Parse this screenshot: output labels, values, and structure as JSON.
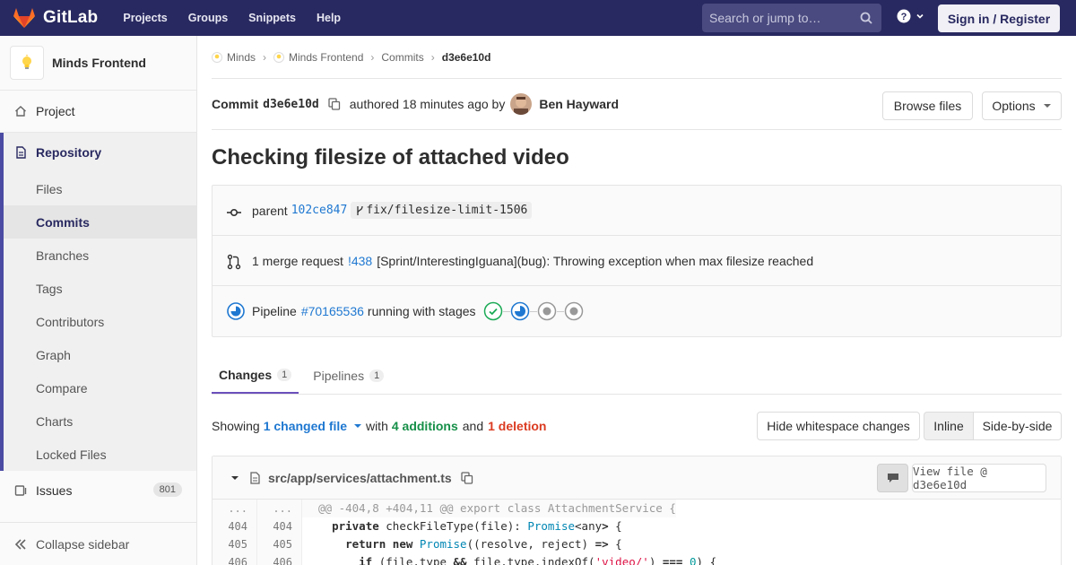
{
  "navbar": {
    "brand": "GitLab",
    "links": [
      "Projects",
      "Groups",
      "Snippets",
      "Help"
    ],
    "search_placeholder": "Search or jump to…",
    "signin_label": "Sign in / Register",
    "brand_color": "#292961"
  },
  "sidebar": {
    "project_name": "Minds Frontend",
    "project_item": "Project",
    "repository_label": "Repository",
    "repo_items": [
      "Files",
      "Commits",
      "Branches",
      "Tags",
      "Contributors",
      "Graph",
      "Compare",
      "Charts",
      "Locked Files"
    ],
    "active_item": "Commits",
    "issues_label": "Issues",
    "issues_count": "801",
    "collapse_label": "Collapse sidebar"
  },
  "breadcrumbs": [
    "Minds",
    "Minds Frontend",
    "Commits",
    "d3e6e10d"
  ],
  "commit": {
    "label": "Commit",
    "sha": "d3e6e10d",
    "authored": "authored 18 minutes ago by",
    "author": "Ben Hayward",
    "browse_files": "Browse files",
    "options": "Options",
    "title": "Checking filesize of attached video"
  },
  "info": {
    "parent_label": "parent",
    "parent_sha": "102ce847",
    "branch": "fix/filesize-limit-1506",
    "mr_count_text": "1 merge request",
    "mr_id": "!438",
    "mr_title": "[Sprint/InterestingIguana](bug): Throwing exception when max filesize reached",
    "pipeline_label": "Pipeline",
    "pipeline_id": "#70165536",
    "pipeline_status": "running with stages",
    "stages": [
      "success",
      "running",
      "created",
      "created"
    ]
  },
  "tabs": [
    {
      "label": "Changes",
      "count": "1"
    },
    {
      "label": "Pipelines",
      "count": "1"
    }
  ],
  "showing": {
    "prefix": "Showing",
    "files": "1 changed file",
    "with": "with",
    "additions": "4 additions",
    "and": "and",
    "deletions": "1 deletion",
    "hide_whitespace": "Hide whitespace changes",
    "inline": "Inline",
    "side_by_side": "Side-by-side"
  },
  "file": {
    "path": "src/app/services/attachment.ts",
    "view_file": "View file @ d3e6e10d",
    "hunk_header": "@@ -404,8 +404,11 @@ export class AttachmentService {",
    "lines": [
      {
        "old": "...",
        "new": "..."
      },
      {
        "old": "404",
        "new": "404"
      },
      {
        "old": "405",
        "new": "405"
      },
      {
        "old": "406",
        "new": "406"
      }
    ]
  }
}
